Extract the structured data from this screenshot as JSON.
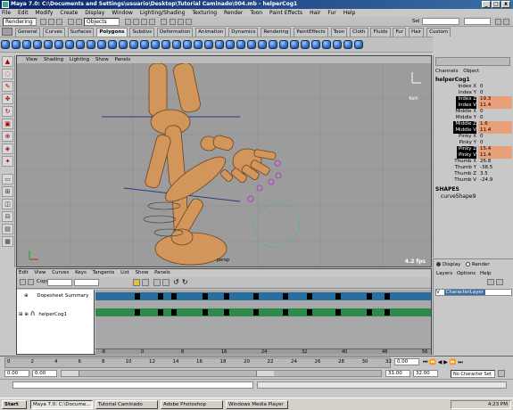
{
  "window": {
    "title": "Maya 7.0: C:\\Documents and Settings\\usuario\\Desktop\\Tutorial Caminado\\004.mb - helperCog1",
    "buttons": [
      "_",
      "□",
      "x"
    ]
  },
  "menubar": [
    "File",
    "Edit",
    "Modify",
    "Create",
    "Display",
    "Window",
    "Lighting/Shading",
    "Texturing",
    "Render",
    "Toon",
    "Paint Effects",
    "Hair",
    "Fur",
    "Help"
  ],
  "statusline": {
    "mode": "Rendering",
    "selection_mask": "Objects",
    "sel_label": "Sel"
  },
  "shelf": {
    "tabs": [
      "General",
      "Curves",
      "Surfaces",
      "Polygons",
      "Subdivs",
      "Deformation",
      "Animation",
      "Dynamics",
      "Rendering",
      "PaintEffects",
      "Toon",
      "Cloth",
      "Fluids",
      "Fur",
      "Hair",
      "Custom"
    ],
    "active": "Polygons",
    "icon_count": 34
  },
  "viewport": {
    "menu": [
      "View",
      "Shading",
      "Lighting",
      "Show",
      "Panels"
    ],
    "fps": "4.2 fps",
    "persp": "persp",
    "axis": "Kelh"
  },
  "channelbox": {
    "tabs": [
      "Channels",
      "Object"
    ],
    "object": "helperCog1",
    "channels": [
      {
        "name": "Index X",
        "value": "0",
        "keyed": false
      },
      {
        "name": "Index Y",
        "value": "0",
        "keyed": false
      },
      {
        "name": "Index Z",
        "value": "19.3",
        "keyed": true
      },
      {
        "name": "Index V",
        "value": "11.4",
        "keyed": true
      },
      {
        "name": "Middle X",
        "value": "0",
        "keyed": false
      },
      {
        "name": "Middle Y",
        "value": "0",
        "keyed": false
      },
      {
        "name": "Middle Z",
        "value": "1.6",
        "keyed": true
      },
      {
        "name": "Middle V",
        "value": "11.4",
        "keyed": true
      },
      {
        "name": "Pinky X",
        "value": "0",
        "keyed": false
      },
      {
        "name": "Pinky Y",
        "value": "0",
        "keyed": false
      },
      {
        "name": "Pinky Z",
        "value": "15.4",
        "keyed": true
      },
      {
        "name": "Pinky V",
        "value": "11.4",
        "keyed": true
      },
      {
        "name": "Thumb X",
        "value": "26.8",
        "keyed": false
      },
      {
        "name": "Thumb Y",
        "value": "-38.5",
        "keyed": false
      },
      {
        "name": "Thumb Z",
        "value": "3.5",
        "keyed": false
      },
      {
        "name": "Thumb V",
        "value": "-24.9",
        "keyed": false
      }
    ],
    "shapes_header": "SHAPES",
    "shape": "curveShape9"
  },
  "layers": {
    "display": "Display",
    "render": "Render",
    "menu": [
      "Layers",
      "Options",
      "Help"
    ],
    "layer_v": "V",
    "layer_name": "CharacterLayer"
  },
  "dopesheet": {
    "menu": [
      "Edit",
      "View",
      "Curves",
      "Keys",
      "Tangents",
      "List",
      "Show",
      "Panels"
    ],
    "copy_label": "Copy",
    "rows": [
      {
        "label": "Dopesheet Summary",
        "color": "#2a6ea0"
      },
      {
        "label": "helperCog1",
        "color": "#2e8a4a"
      }
    ],
    "keys": [
      150,
      176,
      191,
      226,
      250,
      283,
      316,
      343,
      375,
      410,
      430
    ],
    "ruler": [
      "-8",
      "0",
      "8",
      "16",
      "24",
      "32",
      "40",
      "48",
      "56"
    ]
  },
  "timeline": {
    "ticks": [
      "0",
      "2",
      "4",
      "6",
      "8",
      "10",
      "12",
      "14",
      "16",
      "18",
      "20",
      "22",
      "24",
      "26",
      "28",
      "30",
      "32"
    ],
    "current": "0.00"
  },
  "range": {
    "start": "0.00",
    "min": "0.00",
    "end": "31.00",
    "max": "32.00",
    "charset": "No Character Set"
  },
  "taskbar": {
    "start": "Start",
    "items": [
      "Maya 7.0: C:\\Docume...",
      "Tutorial Caminado",
      "Adobe Photoshop",
      "Windows Media Player"
    ],
    "time": "4:23 PM"
  },
  "colors": {
    "accent": "#3a6ea5",
    "keyed": "#e8a07a",
    "skin": "#d2955a",
    "viewport": "#9c9c9c"
  }
}
